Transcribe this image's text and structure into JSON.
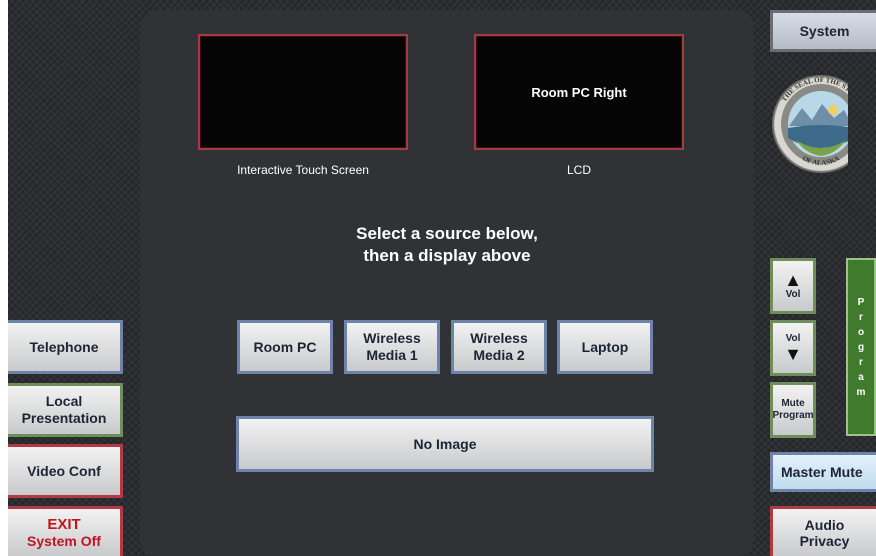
{
  "displays": [
    {
      "screen_text": "",
      "label": "Interactive Touch Screen"
    },
    {
      "screen_text": "Room PC Right",
      "label": "LCD"
    }
  ],
  "instructions": {
    "line1": "Select a source below,",
    "line2": "then a display above"
  },
  "sources": [
    {
      "line1": "Room PC",
      "line2": ""
    },
    {
      "line1": "Wireless",
      "line2": "Media 1"
    },
    {
      "line1": "Wireless",
      "line2": "Media 2"
    },
    {
      "line1": "Laptop",
      "line2": ""
    }
  ],
  "no_image_label": "No Image",
  "left_menu": {
    "telephone": "Telephone",
    "local_presentation": {
      "line1": "Local",
      "line2": "Presentation"
    },
    "video_conf": "Video Conf",
    "exit": {
      "line1": "EXIT",
      "line2": "System Off"
    }
  },
  "right_menu": {
    "system": "System",
    "vol_up": "Vol",
    "vol_down": "Vol",
    "mute_program": {
      "line1": "Mute",
      "line2": "Program"
    },
    "program_letters": [
      "P",
      "r",
      "o",
      "g",
      "r",
      "a",
      "m"
    ],
    "master_mute": "Master Mute",
    "audio_privacy": {
      "line1": "Audio",
      "line2": "Privacy"
    }
  },
  "seal": {
    "top_text": "THE SEAL OF THE STATE",
    "bottom_text": "OF ALASKA",
    "icon": "alaska-state-seal"
  },
  "colors": {
    "panel": "#313235",
    "blue_border": "#6d84a8",
    "green_border": "#6e8f5c",
    "red_border": "#b23a45",
    "exit_text": "#c0141f",
    "program_green": "#3f7a2d",
    "master_mute_bg": "#cfe6f5"
  }
}
